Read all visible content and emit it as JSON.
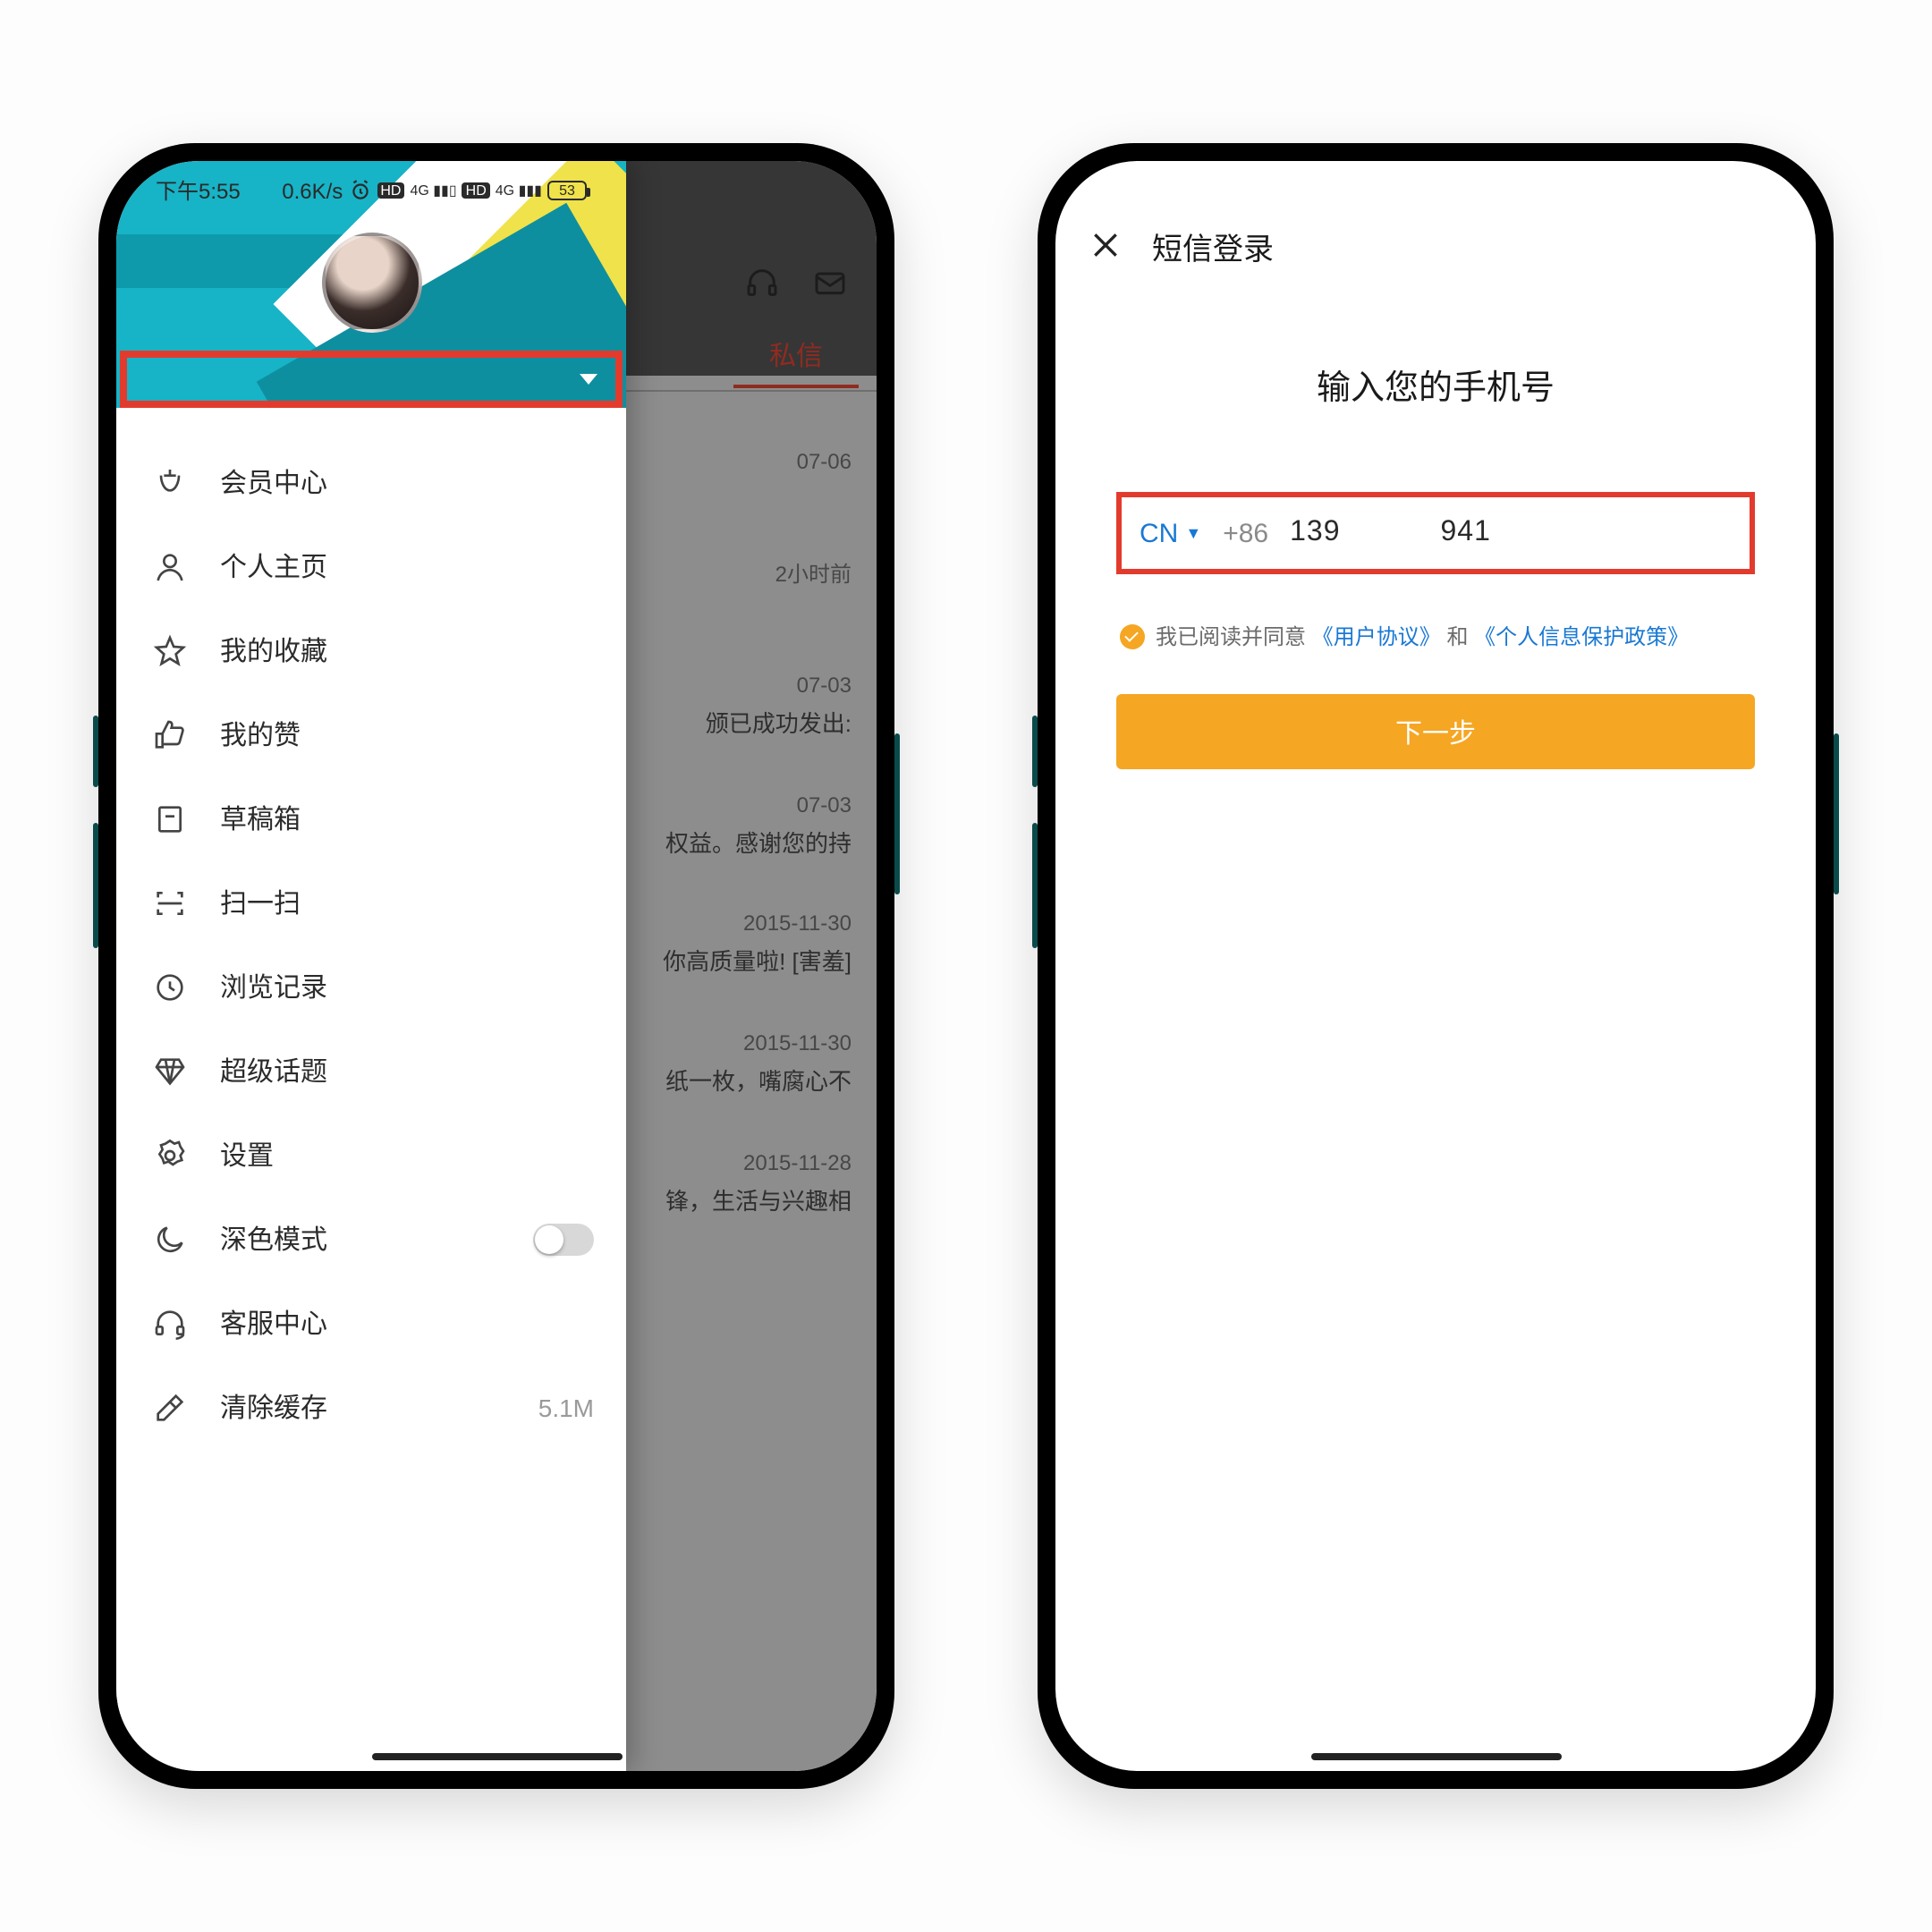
{
  "left": {
    "statusbar": {
      "time": "下午5:55",
      "speed": "0.6K/s",
      "battery": "53"
    },
    "background": {
      "tab_label": "私信",
      "items": [
        {
          "ts": "07-06",
          "txt": ""
        },
        {
          "ts": "2小时前",
          "txt": ""
        },
        {
          "ts": "07-03",
          "txt": "颁已成功发出:"
        },
        {
          "ts": "07-03",
          "txt": "权益。感谢您的持"
        },
        {
          "ts": "2015-11-30",
          "txt": "你高质量啦! [害羞]"
        },
        {
          "ts": "2015-11-30",
          "txt": "纸一枚，嘴腐心不"
        },
        {
          "ts": "2015-11-28",
          "txt": "锋，生活与兴趣相"
        }
      ]
    },
    "menu": [
      {
        "key": "member",
        "label": "会员中心"
      },
      {
        "key": "profile",
        "label": "个人主页"
      },
      {
        "key": "fav",
        "label": "我的收藏"
      },
      {
        "key": "like",
        "label": "我的赞"
      },
      {
        "key": "draft",
        "label": "草稿箱"
      },
      {
        "key": "scan",
        "label": "扫一扫"
      },
      {
        "key": "history",
        "label": "浏览记录"
      },
      {
        "key": "topic",
        "label": "超级话题"
      },
      {
        "key": "settings",
        "label": "设置"
      },
      {
        "key": "dark",
        "label": "深色模式"
      },
      {
        "key": "support",
        "label": "客服中心"
      },
      {
        "key": "cache",
        "label": "清除缓存",
        "tail": "5.1M"
      }
    ]
  },
  "right": {
    "title": "短信登录",
    "heading": "输入您的手机号",
    "country_code": "CN",
    "dial_code": "+86",
    "phone_prefix": "139",
    "phone_suffix": "941",
    "agree_prefix": "我已阅读并同意",
    "link1": "《用户协议》",
    "agree_and": "和",
    "link2": "《个人信息保护政策》",
    "next_label": "下一步"
  }
}
